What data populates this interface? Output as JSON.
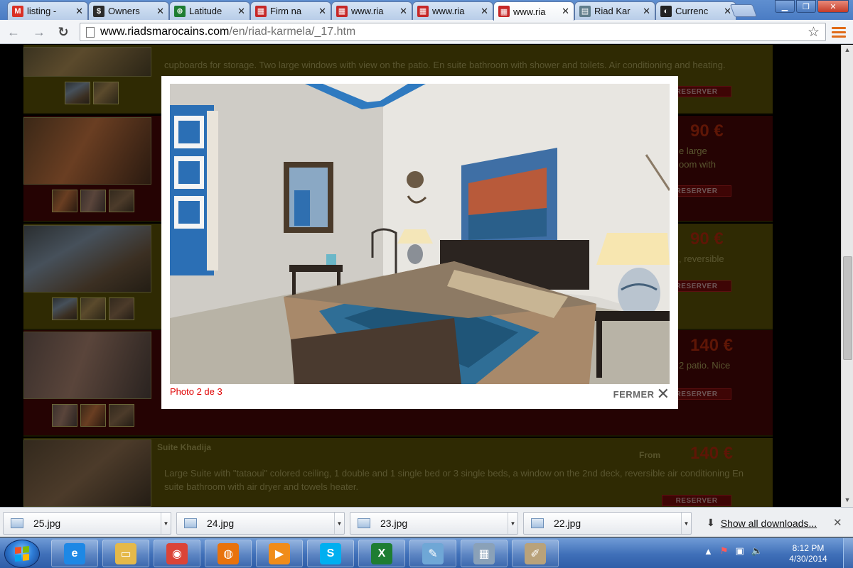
{
  "browser": {
    "tabs": [
      {
        "title": "listing -",
        "icon": "gmail-icon",
        "color": "#d93025",
        "glyph": "M",
        "active": false
      },
      {
        "title": "Owners",
        "icon": "owners-site-icon",
        "color": "#2b2b2b",
        "glyph": "$",
        "active": false
      },
      {
        "title": "Latitude",
        "icon": "globe-icon",
        "color": "#1e7d32",
        "glyph": "⊕",
        "active": false
      },
      {
        "title": "Firm na",
        "icon": "page-grid-icon",
        "color": "#c62828",
        "glyph": "▦",
        "active": false
      },
      {
        "title": "www.ria",
        "icon": "page-grid-icon",
        "color": "#c62828",
        "glyph": "▦",
        "active": false
      },
      {
        "title": "www.ria",
        "icon": "page-grid-icon",
        "color": "#c62828",
        "glyph": "▦",
        "active": false
      },
      {
        "title": "www.ria",
        "icon": "page-grid-icon",
        "color": "#c62828",
        "glyph": "▦",
        "active": true
      },
      {
        "title": "Riad Kar",
        "icon": "document-icon",
        "color": "#607d8b",
        "glyph": "▤",
        "active": false
      },
      {
        "title": "Currenc",
        "icon": "currency-site-icon",
        "color": "#222222",
        "glyph": "◐",
        "active": false
      }
    ],
    "url_domain": "www.riadsmarocains.com",
    "url_path": "/en/riad-karmela/_17.htm"
  },
  "page": {
    "rooms": [
      {
        "name": "",
        "from": "",
        "price": "",
        "reserve": "RESERVER",
        "desc": "cupboards for storage. Two large windows with view on the patio. En suite bathroom with shower and  toilets. Air conditioning and heating.",
        "desc_top": "cupboards for storage. Two large windows with view on the patio. En suite bathroom with shower and  toilets. Air conditioning and heating."
      },
      {
        "name": "",
        "from": "",
        "price": "90 €",
        "reserve": "RESERVER",
        "desc": "e large\noom with"
      },
      {
        "name": "",
        "from": "",
        "price": "90 €",
        "reserve": "RESERVER",
        "desc": ", reversible"
      },
      {
        "name": "",
        "from": "",
        "price": "140 €",
        "reserve": "RESERVER",
        "desc": "2 patio. Nice"
      },
      {
        "name": "Suite Khadija",
        "from": "From",
        "price": "140 €",
        "reserve": "RESERVER",
        "desc": "Large Suite with \"tataoui\" colored ceiling, 1 double and 1 single bed or 3 single beds, a window on the 2nd deck, reversible air conditioning En suite bathroom with air dryer and towels heater."
      }
    ]
  },
  "lightbox": {
    "caption": "Photo 2 de 3",
    "close_label": "FERMER"
  },
  "downloads": {
    "items": [
      "25.jpg",
      "24.jpg",
      "23.jpg",
      "22.jpg"
    ],
    "show_all": "Show all downloads..."
  },
  "taskbar": {
    "apps": [
      {
        "icon": "internet-explorer-icon",
        "color": "#1e88e5",
        "glyph": "e"
      },
      {
        "icon": "file-explorer-icon",
        "color": "#e5b94a",
        "glyph": "▭"
      },
      {
        "icon": "chrome-icon",
        "color": "#db4437",
        "glyph": "◉"
      },
      {
        "icon": "firefox-icon",
        "color": "#e8720c",
        "glyph": "◍"
      },
      {
        "icon": "media-player-icon",
        "color": "#f08c1a",
        "glyph": "▶"
      },
      {
        "icon": "skype-icon",
        "color": "#00aff0",
        "glyph": "S"
      },
      {
        "icon": "excel-icon",
        "color": "#1e7d32",
        "glyph": "X"
      },
      {
        "icon": "notepad-icon",
        "color": "#6fa7d6",
        "glyph": "✎"
      },
      {
        "icon": "calculator-icon",
        "color": "#8aa1b8",
        "glyph": "▦"
      },
      {
        "icon": "paint-icon",
        "color": "#b9a27a",
        "glyph": "✐"
      }
    ],
    "time": "8:12 PM",
    "date": "4/30/2014"
  }
}
